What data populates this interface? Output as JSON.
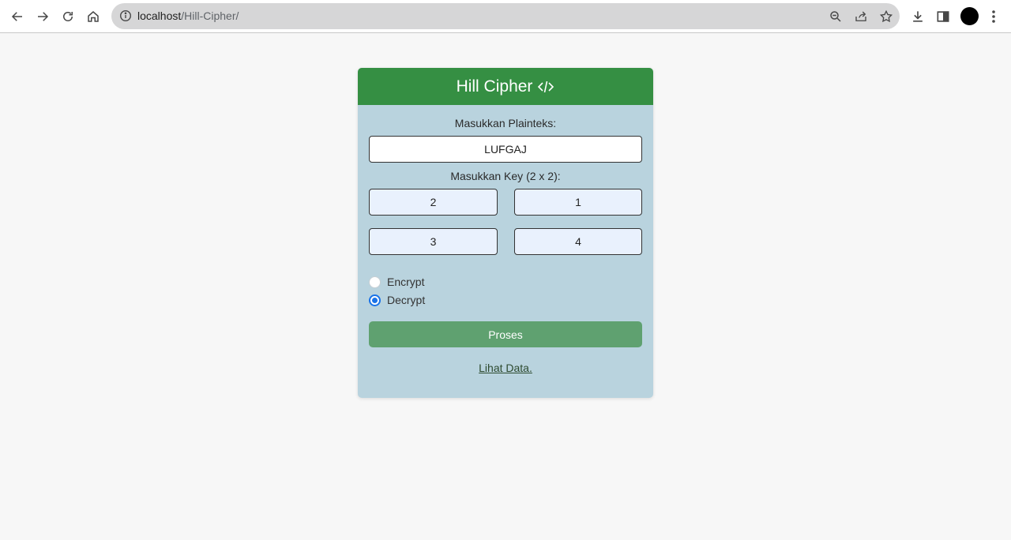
{
  "browser": {
    "url_host": "localhost",
    "url_path": "/Hill-Cipher/"
  },
  "card": {
    "title": "Hill Cipher",
    "plaintext_label": "Masukkan Plainteks:",
    "plaintext_value": "LUFGAJ",
    "key_label": "Masukkan Key (2 x 2):",
    "keys": [
      "2",
      "1",
      "3",
      "4"
    ],
    "mode_options": [
      {
        "label": "Encrypt",
        "checked": false
      },
      {
        "label": "Decrypt",
        "checked": true
      }
    ],
    "submit_label": "Proses",
    "link_label": "Lihat Data."
  },
  "colors": {
    "header": "#358f43",
    "card_bg": "#b9d3de",
    "button": "#5fa170",
    "radio_accent": "#1a73e8"
  }
}
